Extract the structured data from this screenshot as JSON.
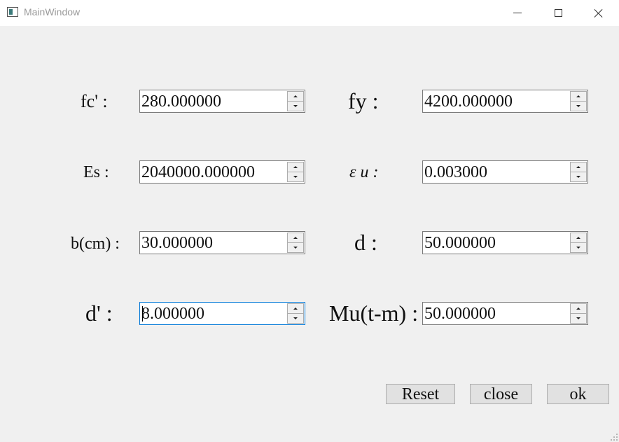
{
  "window": {
    "title": "MainWindow",
    "icon": "app-window-icon",
    "controls": [
      "minimize-icon",
      "maximize-icon",
      "close-icon"
    ]
  },
  "fields": [
    {
      "id": "fc",
      "label": "fc' :",
      "value": "280.000000"
    },
    {
      "id": "fy",
      "label": "fy :",
      "value": "4200.000000"
    },
    {
      "id": "es",
      "label": "Es :",
      "value": "2040000.000000"
    },
    {
      "id": "eu",
      "label": "ε u :",
      "value": "0.003000"
    },
    {
      "id": "b",
      "label": "b(cm) :",
      "value": "30.000000"
    },
    {
      "id": "d",
      "label": "d :",
      "value": "50.000000"
    },
    {
      "id": "dprime",
      "label": "d' :",
      "value": "8.000000"
    },
    {
      "id": "mu",
      "label": "Mu(t-m) :",
      "value": "50.000000"
    }
  ],
  "buttons": {
    "reset": "Reset",
    "close": "close",
    "ok": "ok"
  }
}
